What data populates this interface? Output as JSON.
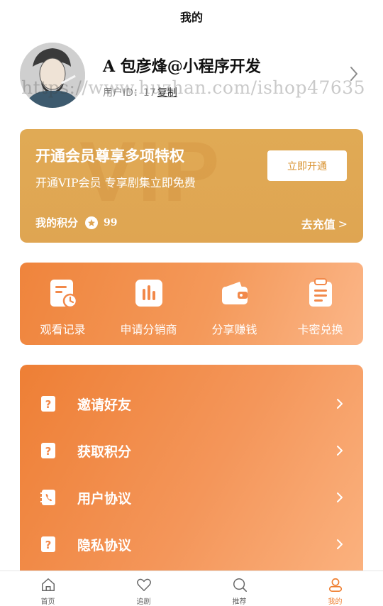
{
  "header": {
    "title": "我的"
  },
  "profile": {
    "name": "A 包彦烽@小程序开发",
    "user_id_label": "用户ID：",
    "user_id_value": "17",
    "copy_label": "复制"
  },
  "watermark": "https://www.huzhan.com/ishop47635",
  "vip": {
    "bg_text": "VIP",
    "title": "开通会员尊享多项特权",
    "subtitle": "开通VIP会员 专享剧集立即免费",
    "button_label": "立即开通",
    "points_label": "我的积分",
    "points_value": "99",
    "recharge_label": "去充值",
    "recharge_chevron": ">"
  },
  "quick_actions": [
    {
      "label": "观看记录",
      "icon": "watch-history-icon"
    },
    {
      "label": "申请分销商",
      "icon": "bar-chart-icon"
    },
    {
      "label": "分享赚钱",
      "icon": "wallet-icon"
    },
    {
      "label": "卡密兑换",
      "icon": "clipboard-icon"
    }
  ],
  "menu": [
    {
      "label": "邀请好友",
      "icon": "question-mark-icon"
    },
    {
      "label": "获取积分",
      "icon": "question-mark-icon"
    },
    {
      "label": "用户协议",
      "icon": "phone-book-icon"
    },
    {
      "label": "隐私协议",
      "icon": "question-mark-icon"
    }
  ],
  "tabs": [
    {
      "label": "首页",
      "icon": "home-icon",
      "active": false
    },
    {
      "label": "追剧",
      "icon": "heart-icon",
      "active": false
    },
    {
      "label": "推荐",
      "icon": "search-icon",
      "active": false
    },
    {
      "label": "我的",
      "icon": "user-icon",
      "active": true
    }
  ],
  "colors": {
    "accent": "#ef7f31",
    "vip_card": "#e0aa55",
    "gradient_start": "#ee7f35",
    "gradient_end": "#fbb27f"
  }
}
